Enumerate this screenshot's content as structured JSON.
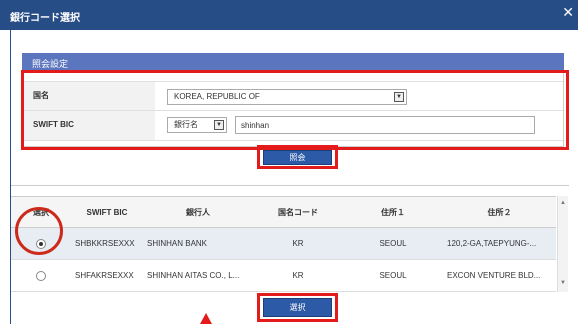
{
  "window": {
    "title": "銀行コード選択",
    "close_icon": "close-icon"
  },
  "search_section": {
    "header": "照会設定",
    "country_label": "国名",
    "country_value": "KOREA, REPUBLIC OF",
    "swift_label": "SWIFT BIC",
    "search_type_value": "銀行名",
    "search_text": "shinhan",
    "search_button": "照会"
  },
  "results": {
    "columns": [
      "選択",
      "SWIFT BIC",
      "銀行人",
      "国名コード",
      "住所１",
      "住所２"
    ],
    "rows": [
      {
        "selected": true,
        "swift": "SHBKKRSEXXX",
        "bank": "SHINHAN BANK",
        "country": "KR",
        "addr1": "SEOUL",
        "addr2": "120,2-GA,TAEPYUNG-..."
      },
      {
        "selected": false,
        "swift": "SHFAKRSEXXX",
        "bank": "SHINHAN AITAS CO., L...",
        "country": "KR",
        "addr1": "SEOUL",
        "addr2": "EXCON VENTURE BLD..."
      }
    ],
    "select_button": "選択"
  },
  "colors": {
    "title_bar": "#274d86",
    "section_header": "#5b76bf",
    "primary_button": "#2d5aa6",
    "highlight": "#e31b1b"
  }
}
